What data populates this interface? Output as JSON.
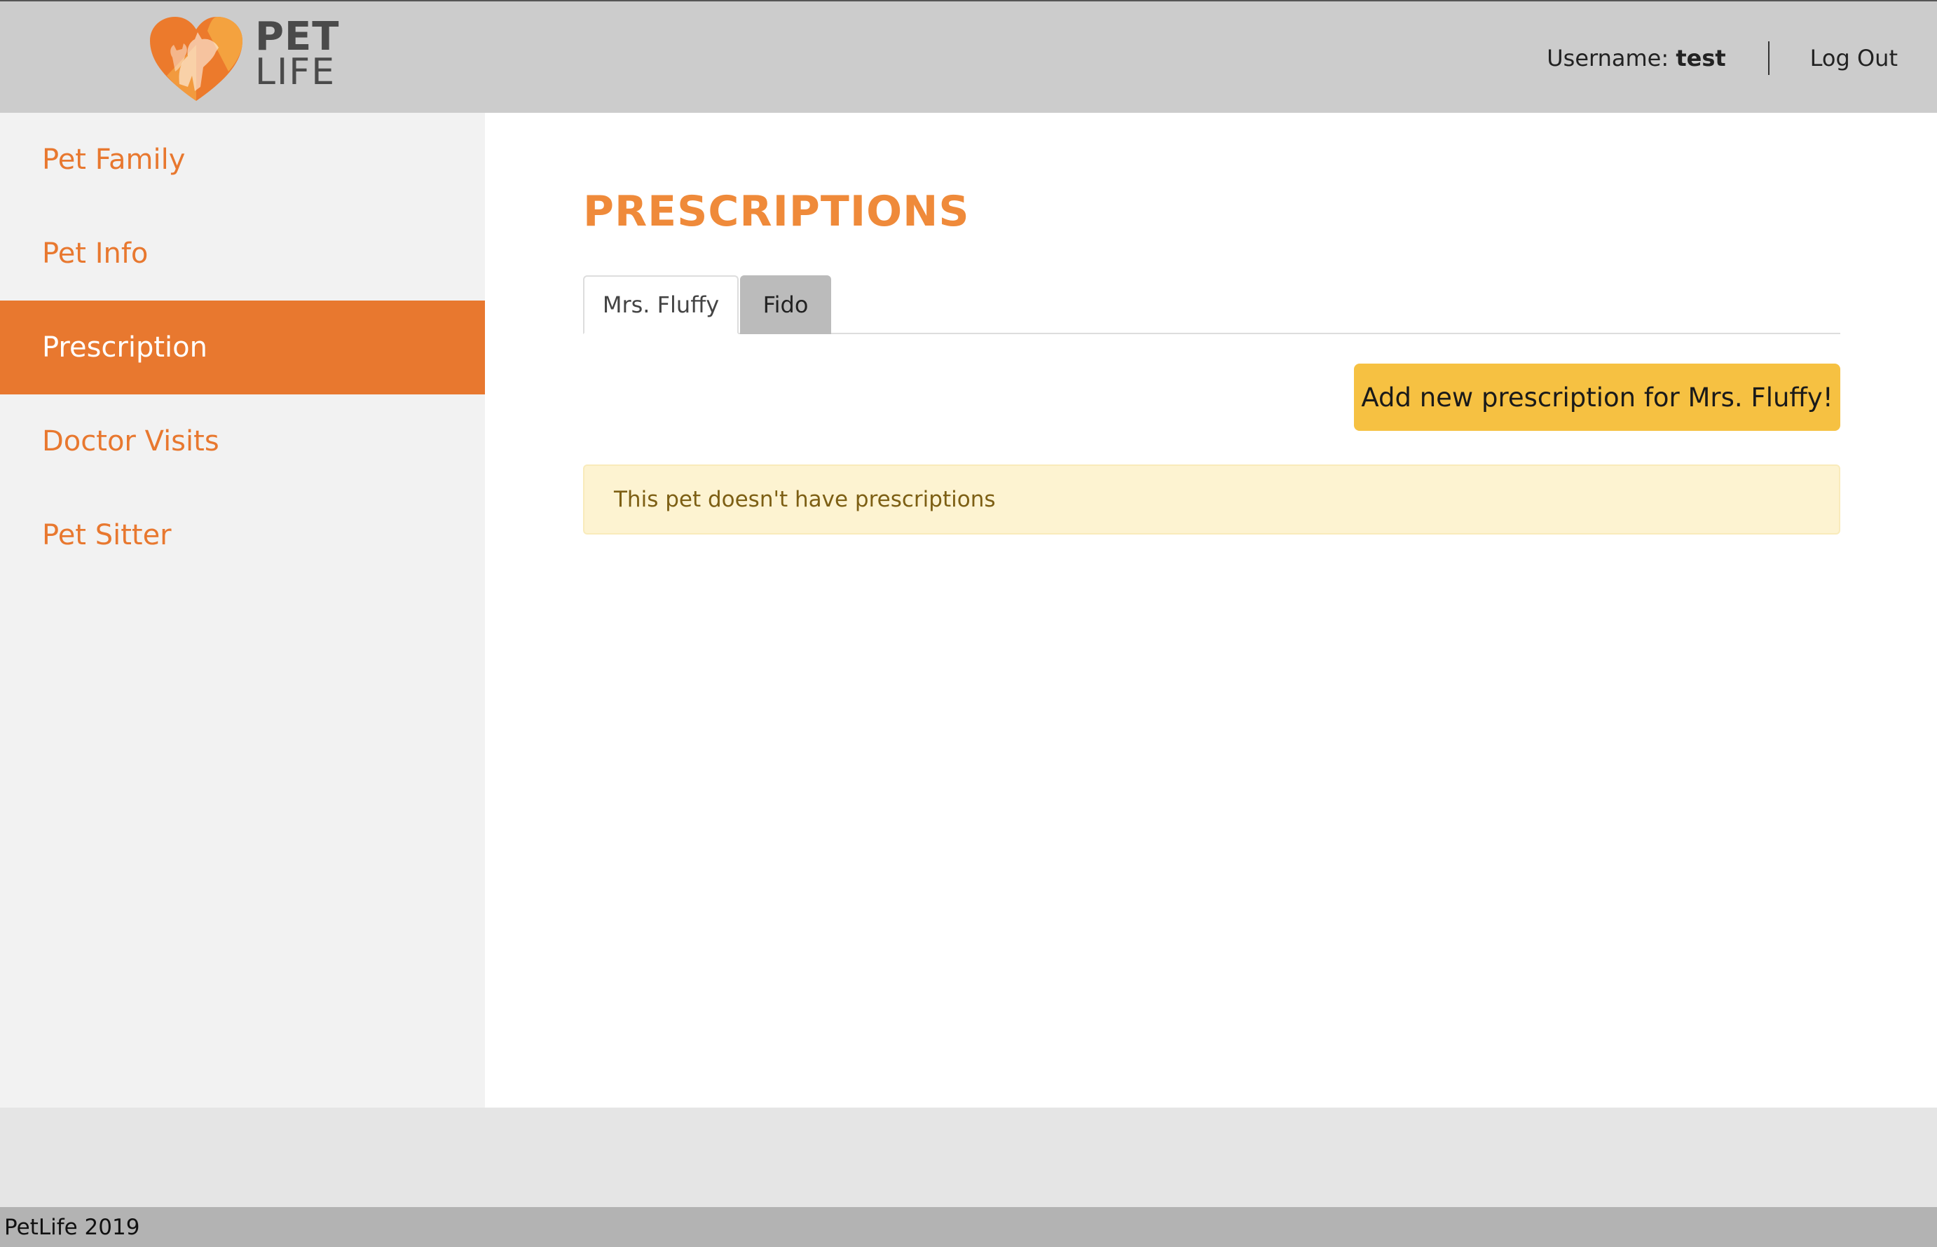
{
  "brand": {
    "name_line1": "PET",
    "name_line2": "LIFE",
    "accent": "#e8782f",
    "logo_icon": "heart-pets-icon"
  },
  "header": {
    "username_label": "Username:",
    "username_value": "test",
    "logout_label": "Log Out"
  },
  "sidebar": {
    "items": [
      {
        "label": "Pet Family",
        "active": false
      },
      {
        "label": "Pet Info",
        "active": false
      },
      {
        "label": "Prescription",
        "active": true
      },
      {
        "label": "Doctor Visits",
        "active": false
      },
      {
        "label": "Pet Sitter",
        "active": false
      }
    ]
  },
  "main": {
    "title": "PRESCRIPTIONS",
    "tabs": [
      {
        "label": "Mrs. Fluffy",
        "active": true
      },
      {
        "label": "Fido",
        "active": false
      }
    ],
    "add_button_label": "Add new prescription for Mrs. Fluffy!",
    "alert_text": "This pet doesn't have prescriptions"
  },
  "footer": {
    "text": "PetLife 2019"
  },
  "colors": {
    "title": "#ef8a3a",
    "button": "#f6c142",
    "alert_bg": "#fdf3d1",
    "topbar": "#cccccc",
    "sidebar": "#f2f2f2"
  }
}
